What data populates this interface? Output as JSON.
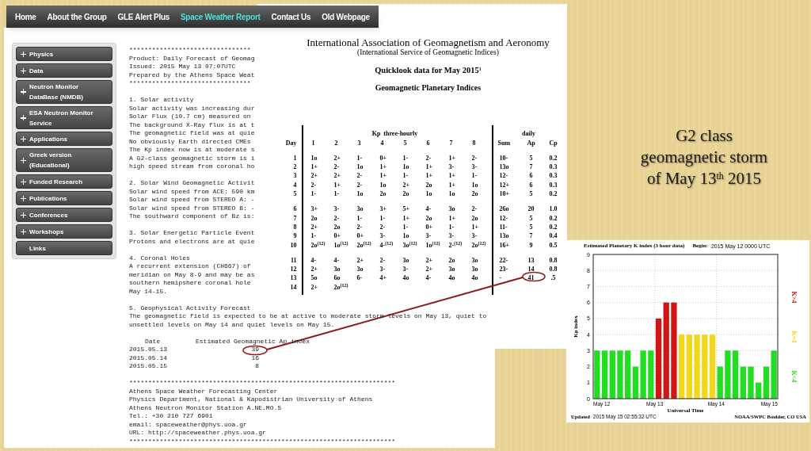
{
  "nav": {
    "items": [
      {
        "label": "Home",
        "selected": false
      },
      {
        "label": "About the Group",
        "selected": false
      },
      {
        "label": "GLE Alert Plus",
        "selected": false
      },
      {
        "label": "Space Weather Report",
        "selected": true
      },
      {
        "label": "Contact Us",
        "selected": false
      },
      {
        "label": "Old Webpage",
        "selected": false
      }
    ]
  },
  "sidebar": {
    "items": [
      {
        "label": "Physics",
        "expandable": true
      },
      {
        "label": "Data",
        "expandable": true
      },
      {
        "label": "Neutron Monitor DataBase (NMDB)",
        "expandable": true
      },
      {
        "label": "ESA Neutron Monitor Service",
        "expandable": true
      },
      {
        "label": "Applications",
        "expandable": true
      },
      {
        "label": "Greek version (Educational)",
        "expandable": true
      },
      {
        "label": "Funded Research",
        "expandable": true
      },
      {
        "label": "Publications",
        "expandable": true
      },
      {
        "label": "Conferences",
        "expandable": true
      },
      {
        "label": "Workshops",
        "expandable": true
      },
      {
        "label": "Links",
        "expandable": false
      }
    ]
  },
  "bulletin": {
    "blocks": [
      {
        "kind": "text",
        "lines": [
          "********************************",
          "Product: Daily Forecast of Geomag",
          "Issued: 2015 May 13 07:07UTC",
          "Prepared by the Athens Space Weat",
          "********************************"
        ]
      },
      {
        "kind": "text",
        "lines": [
          "1. Solar activity",
          "Solar activity was increasing dur",
          "Solar Flux (10.7 cm) measured on",
          "The background X-Ray flux is at t",
          "The geomagnetic field was at quie",
          "No obviously Earth directed CMEs",
          "The Kp index now is at moderate s",
          "A G2-class geomagnetic storm is i",
          "high speed stream from coronal ho"
        ]
      },
      {
        "kind": "text",
        "lines": [
          "2. Solar Wind Geomagnetic Activit",
          "Solar wind speed from ACE: 590 km",
          "Solar wind speed from STEREO A: -",
          "Solar wind speed from STEREO B: -",
          "The southward component of Bz is:"
        ]
      },
      {
        "kind": "text",
        "lines": [
          "3. Solar Energetic Particle Event",
          "Protons and electrons are at quie"
        ]
      },
      {
        "kind": "text",
        "lines": [
          "4. Coronal Holes",
          "A recurrent extension (CH667) of",
          "meridian on May 8-9 and may be as",
          "southern hemipshere coronal hole",
          "May 14-15."
        ]
      },
      {
        "kind": "text",
        "lines": [
          "5. Geophysical Activity Forecast",
          "The geomagnetic field is expected to be at active to moderate storm levels on May 13, quiet to",
          "unsettled levels on May 14 and quiet levels on May 15."
        ]
      },
      {
        "kind": "forecast",
        "columns": [
          "Date",
          "Estimated Geomagnetic Ap index"
        ],
        "rows": [
          {
            "date": "2015.05.13",
            "ap": "39"
          },
          {
            "date": "2015.05.14",
            "ap": "16"
          },
          {
            "date": "2015.05.15",
            "ap": "8"
          }
        ]
      },
      {
        "kind": "text",
        "lines": [
          "**********************************************************************",
          "Athens Space Weather Forecasting Center",
          "Physics Department, National & Kapodistrian University of Athens",
          "Athens Neutron Monitor Station A.NE.MO.S",
          "Tel.: +30 210 727 6901",
          "email: spaceweather@phys.uoa.gr",
          "URL: http://spaceweather.phys.uoa.gr",
          "**********************************************************************"
        ]
      }
    ]
  },
  "indices": {
    "title": "International Association of Geomagnetism and Aeronomy",
    "subtitle": "(International Service of Geomagnetic Indices)",
    "heading": "Quicklook data for May 2015$^{1}$",
    "subheading": "Geomagnetic Planetary Indices",
    "group_headers": {
      "kp": "Kp  three-hourly",
      "daily": "daily"
    },
    "columns": {
      "day": "Day",
      "kp": [
        "1",
        "2",
        "3",
        "4",
        "5",
        "6",
        "7",
        "8"
      ],
      "daily": [
        "Sum",
        "Ap",
        "Cp"
      ]
    },
    "groups": [
      [
        {
          "day": "1",
          "kp": [
            "1o",
            "2+",
            "1-",
            "0+",
            "1-",
            "2-",
            "1+",
            "2-"
          ],
          "daily": [
            "10-",
            "5",
            "0.2"
          ]
        },
        {
          "day": "2",
          "kp": [
            "1+",
            "2-",
            "1o",
            "1+",
            "1o",
            "1+",
            "3-",
            "3-"
          ],
          "daily": [
            "13o",
            "7",
            "0.3"
          ]
        },
        {
          "day": "3",
          "kp": [
            "2+",
            "2+",
            "2-",
            "1+",
            "1-",
            "1+",
            "1+",
            "1-"
          ],
          "daily": [
            "12-",
            "6",
            "0.3"
          ]
        },
        {
          "day": "4",
          "kp": [
            "2-",
            "1+",
            "2-",
            "1o",
            "2+",
            "2o",
            "1+",
            "1o"
          ],
          "daily": [
            "12+",
            "6",
            "0.3"
          ]
        },
        {
          "day": "5",
          "kp": [
            "1-",
            "1-",
            "1o",
            "2o",
            "2o",
            "1o",
            "1o",
            "2o"
          ],
          "daily": [
            "10+",
            "5",
            "0.2"
          ]
        }
      ],
      [
        {
          "day": "6",
          "kp": [
            "3+",
            "3-",
            "3o",
            "3+",
            "5+",
            "4-",
            "3o",
            "2-"
          ],
          "daily": [
            "26o",
            "20",
            "1.0"
          ]
        },
        {
          "day": "7",
          "kp": [
            "2o",
            "2-",
            "1-",
            "1-",
            "1+",
            "2o",
            "1+",
            "2o"
          ],
          "daily": [
            "12-",
            "5",
            "0.2"
          ]
        },
        {
          "day": "8",
          "kp": [
            "2+",
            "2o",
            "2-",
            "2-",
            "1-",
            "0+",
            "1-",
            "1+"
          ],
          "daily": [
            "11-",
            "5",
            "0.2"
          ]
        },
        {
          "day": "9",
          "kp": [
            "1-",
            "0+",
            "0+",
            "3-",
            "1o",
            "3-",
            "3-",
            "3-"
          ],
          "daily": [
            "13o",
            "7",
            "0.4"
          ]
        },
        {
          "day": "10",
          "kp": [
            "2o$^{(12)}$",
            "1o$^{(12)}$",
            "2o$^{(12)}$",
            "4-$^{(12)}$",
            "3o$^{(12)}$",
            "1o$^{(12)}$",
            "2-$^{(12)}$",
            "2o$^{(12)}$"
          ],
          "daily": [
            "16+",
            "9",
            "0.5"
          ]
        }
      ],
      [
        {
          "day": "11",
          "kp": [
            "4-",
            "4-",
            "2+",
            "2-",
            "3o",
            "2+",
            "2o",
            "3o"
          ],
          "daily": [
            "22-",
            "13",
            "0.8"
          ]
        },
        {
          "day": "12",
          "kp": [
            "2+",
            "3o",
            "3o",
            "3-",
            "3-",
            "2+",
            "3o",
            "3o"
          ],
          "daily": [
            "23-",
            "14",
            "0.8"
          ]
        },
        {
          "day": "13",
          "kp": [
            "5o",
            "6o",
            "6-",
            "4+",
            "4o",
            "4-",
            "4o",
            "4o"
          ],
          "daily": [
            "-",
            "41",
            ".5"
          ]
        },
        {
          "day": "14",
          "kp": [
            "2+",
            "2o$^{(12)}$"
          ]
        }
      ]
    ]
  },
  "slide_title": "G2 class geomagnetic storm of May 13$^{th}$ 2015",
  "kp_chart": {
    "begin_label": "Begin:",
    "begin_value": "2015 May 12 0000 UTC",
    "updated_label": "Updated",
    "updated_value": "2015 May 15 02:55:32 UTC",
    "credit": "NOAA/SWPC Boulder, CO USA",
    "x_labels": [
      "May 12",
      "May 13",
      "May 14",
      "May 15"
    ],
    "chart_data": {
      "type": "bar",
      "grid": true,
      "title": "Estimated Planetary K index (3 hour data)",
      "xlabel": "Universal Time",
      "ylabel": "Kp index",
      "ylim": [
        0,
        9
      ],
      "yticks": [
        0,
        1,
        2,
        3,
        4,
        5,
        6,
        7,
        8,
        9
      ],
      "series": [
        {
          "name": "K<4",
          "color": "#22dd22",
          "values": [
            3,
            3,
            3,
            3,
            3,
            2,
            3,
            3,
            null,
            null,
            null,
            null,
            null,
            null,
            null,
            null,
            2,
            3,
            3,
            2,
            2,
            1,
            2,
            3
          ]
        },
        {
          "name": "K=4",
          "color": "#f2d81c",
          "values": [
            null,
            null,
            null,
            null,
            null,
            null,
            null,
            null,
            null,
            null,
            null,
            4,
            4,
            4,
            4,
            4,
            null,
            null,
            null,
            null,
            null,
            null,
            null,
            null
          ]
        },
        {
          "name": "K>4",
          "color": "#d01515",
          "values": [
            null,
            null,
            null,
            null,
            null,
            null,
            null,
            null,
            5,
            6,
            6,
            null,
            null,
            null,
            null,
            null,
            null,
            null,
            null,
            null,
            null,
            null,
            null,
            null
          ]
        }
      ]
    }
  }
}
